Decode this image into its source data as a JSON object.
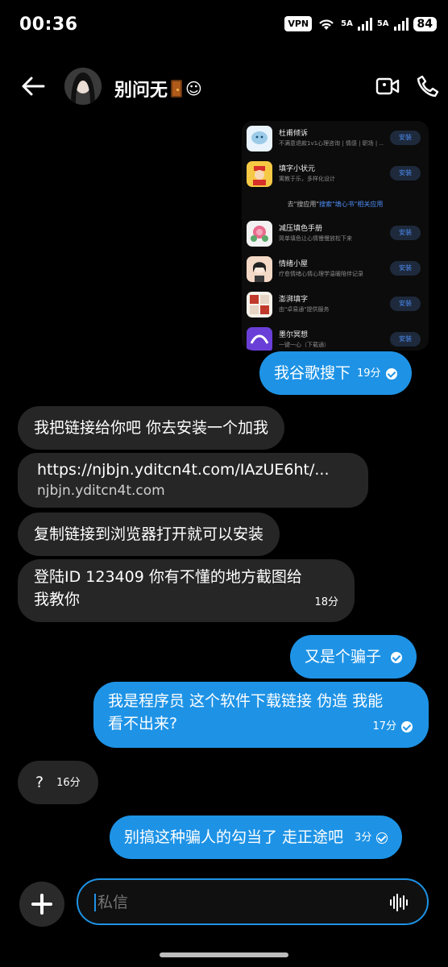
{
  "status_bar": {
    "time": "00:36",
    "vpn": "VPN",
    "network1": "5A",
    "network2": "5A",
    "battery": "84"
  },
  "header": {
    "contact_name": "别问无",
    "emoji_suffix": "☺"
  },
  "shared_image": {
    "apps": [
      {
        "name": "杜甫倾诉",
        "desc": "不满意退款1v1心理咨询 | 情感 | 职场 | ...",
        "install": "安装",
        "icon_color": "#e9f3fb"
      },
      {
        "name": "填字小状元",
        "desc": "寓教于乐，多样化设计",
        "install": "安装",
        "icon_color": "#f6c945"
      },
      {
        "name": "减压填色手册",
        "desc": "简单填色让心情慢慢放松下来",
        "install": "安装",
        "icon_color": "#f2f2f2"
      },
      {
        "name": "情绪小屋",
        "desc": "疗愈情绪心情心理学温暖陪伴记录",
        "install": "安装",
        "icon_color": "#f4d9c6"
      },
      {
        "name": "澎湃填字",
        "desc": "由\"卓易通\"提供服务",
        "install": "安装",
        "icon_color": "#f7f2ea"
      },
      {
        "name": "墨尔冥想",
        "desc": "一键一心（下载通）",
        "install": "安装",
        "icon_color": "#6a3fd8"
      }
    ],
    "search_tip_prefix": "去\"搜应用\"",
    "search_tip_highlight": "搜索\"填心书\"相关应用"
  },
  "messages": [
    {
      "dir": "out",
      "text": "我谷歌搜下",
      "time": "19分",
      "read": true
    },
    {
      "dir": "in",
      "text": "我把链接给你吧 你去安装一个加我"
    },
    {
      "dir": "in",
      "link": "https://njbjn.yditcn4t.com/IAzUE6ht/...",
      "domain": "njbjn.yditcn4t.com"
    },
    {
      "dir": "in",
      "text": "复制链接到浏览器打开就可以安装"
    },
    {
      "dir": "in",
      "text_line1": "登陆ID 123409 你有不懂的地方截图给",
      "text_line2": "我教你",
      "time": "18分"
    },
    {
      "dir": "out",
      "text": "又是个骗子",
      "read": true
    },
    {
      "dir": "out",
      "text_line1": "我是程序员 这个软件下载链接 伪造 我能",
      "text_line2": "看不出来?",
      "time": "17分",
      "read": true
    },
    {
      "dir": "in",
      "text": "?",
      "time": "16分"
    },
    {
      "dir": "out",
      "text": "别搞这种骗人的勾当了 走正途吧",
      "time": "3分",
      "read": false
    }
  ],
  "composer": {
    "placeholder": "私信"
  }
}
